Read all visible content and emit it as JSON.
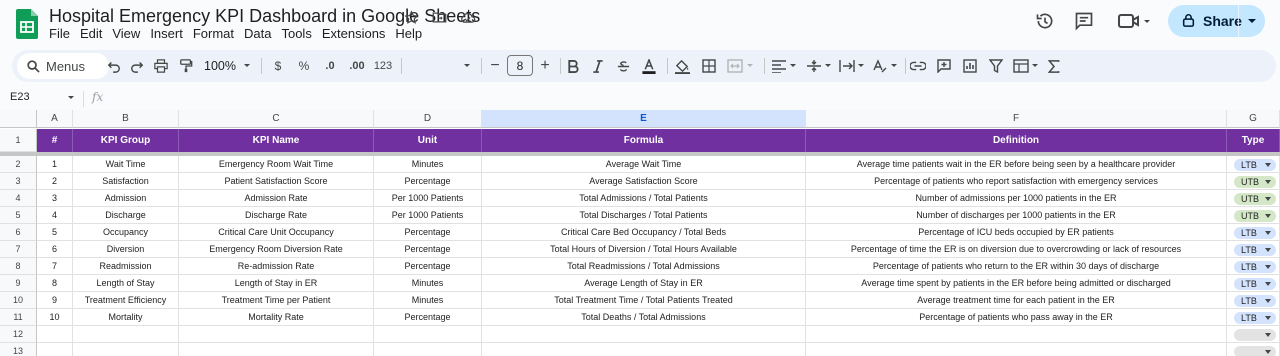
{
  "title_bar": {
    "doc_title": "Hospital Emergency KPI Dashboard in Google Sheets",
    "share_label": "Share",
    "icons": [
      "star-icon",
      "move-to-folder-icon",
      "cloud-status-icon",
      "history-icon",
      "comments-icon",
      "meet-icon",
      "lock-icon"
    ]
  },
  "menu": [
    "File",
    "Edit",
    "View",
    "Insert",
    "Format",
    "Data",
    "Tools",
    "Extensions",
    "Help"
  ],
  "toolbar": {
    "search_label": "Menus",
    "zoom": "100%",
    "currency": "$",
    "percent": "%",
    "dec_decrease": ".0",
    "dec_increase": ".00",
    "more_formats": "123",
    "font_size": "8",
    "minus": "−",
    "plus": "+"
  },
  "formula_bar": {
    "cell_ref": "E23",
    "fx": "fx"
  },
  "columns": [
    "A",
    "B",
    "C",
    "D",
    "E",
    "F",
    "G"
  ],
  "row_numbers": [
    "1",
    "2",
    "3",
    "4",
    "5",
    "6",
    "7",
    "8",
    "9",
    "10",
    "11",
    "12",
    "13"
  ],
  "header": [
    "#",
    "KPI Group",
    "KPI Name",
    "Unit",
    "Formula",
    "Definition",
    "Type"
  ],
  "rows": [
    [
      "1",
      "Wait Time",
      "Emergency Room Wait Time",
      "Minutes",
      "Average Wait Time",
      "Average time patients wait in the ER before being seen by a healthcare provider",
      "LTB"
    ],
    [
      "2",
      "Satisfaction",
      "Patient Satisfaction Score",
      "Percentage",
      "Average Satisfaction Score",
      "Percentage of patients who report satisfaction with emergency services",
      "UTB"
    ],
    [
      "3",
      "Admission",
      "Admission Rate",
      "Per 1000 Patients",
      "Total Admissions / Total Patients",
      "Number of admissions per 1000 patients in the ER",
      "UTB"
    ],
    [
      "4",
      "Discharge",
      "Discharge Rate",
      "Per 1000 Patients",
      "Total Discharges / Total Patients",
      "Number of discharges per 1000 patients in the ER",
      "UTB"
    ],
    [
      "5",
      "Occupancy",
      "Critical Care Unit Occupancy",
      "Percentage",
      "Critical Care Bed Occupancy / Total Beds",
      "Percentage of ICU beds occupied by ER patients",
      "LTB"
    ],
    [
      "6",
      "Diversion",
      "Emergency Room Diversion Rate",
      "Percentage",
      "Total Hours of Diversion / Total Hours Available",
      "Percentage of time the ER is on diversion due to overcrowding or lack of resources",
      "LTB"
    ],
    [
      "7",
      "Readmission",
      "Re-admission Rate",
      "Percentage",
      "Total Readmissions / Total Admissions",
      "Percentage of patients who return to the ER within 30 days of discharge",
      "LTB"
    ],
    [
      "8",
      "Length of Stay",
      "Length of Stay in ER",
      "Minutes",
      "Average Length of Stay in ER",
      "Average time spent by patients in the ER before being admitted or discharged",
      "LTB"
    ],
    [
      "9",
      "Treatment Efficiency",
      "Treatment Time per Patient",
      "Minutes",
      "Total Treatment Time / Total Patients Treated",
      "Average treatment time for each patient in the ER",
      "LTB"
    ],
    [
      "10",
      "Mortality",
      "Mortality Rate",
      "Percentage",
      "Total Deaths / Total Admissions",
      "Percentage of patients who pass away in the ER",
      "LTB"
    ]
  ],
  "colors": {
    "header_bg": "#7030a0",
    "ltb_chip": "#d3e3fd",
    "utb_chip": "#d4e8c8",
    "share_bg": "#c2e7ff",
    "logo_green": "#0f9d58"
  }
}
